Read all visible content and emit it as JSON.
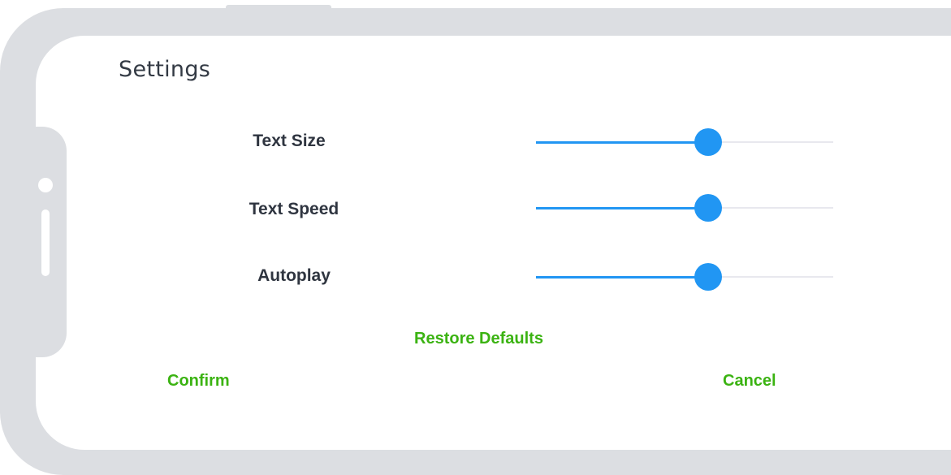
{
  "settings": {
    "title": "Settings",
    "items": [
      {
        "label": "Text Size",
        "value": 0.58
      },
      {
        "label": "Text Speed",
        "value": 0.58
      },
      {
        "label": "Autoplay",
        "value": 0.58
      }
    ],
    "restore_label": "Restore Defaults",
    "confirm_label": "Confirm",
    "cancel_label": "Cancel"
  },
  "colors": {
    "accent": "#2196f3",
    "action": "#3bb312",
    "frame": "#dcdee2",
    "text": "#2f3540"
  }
}
